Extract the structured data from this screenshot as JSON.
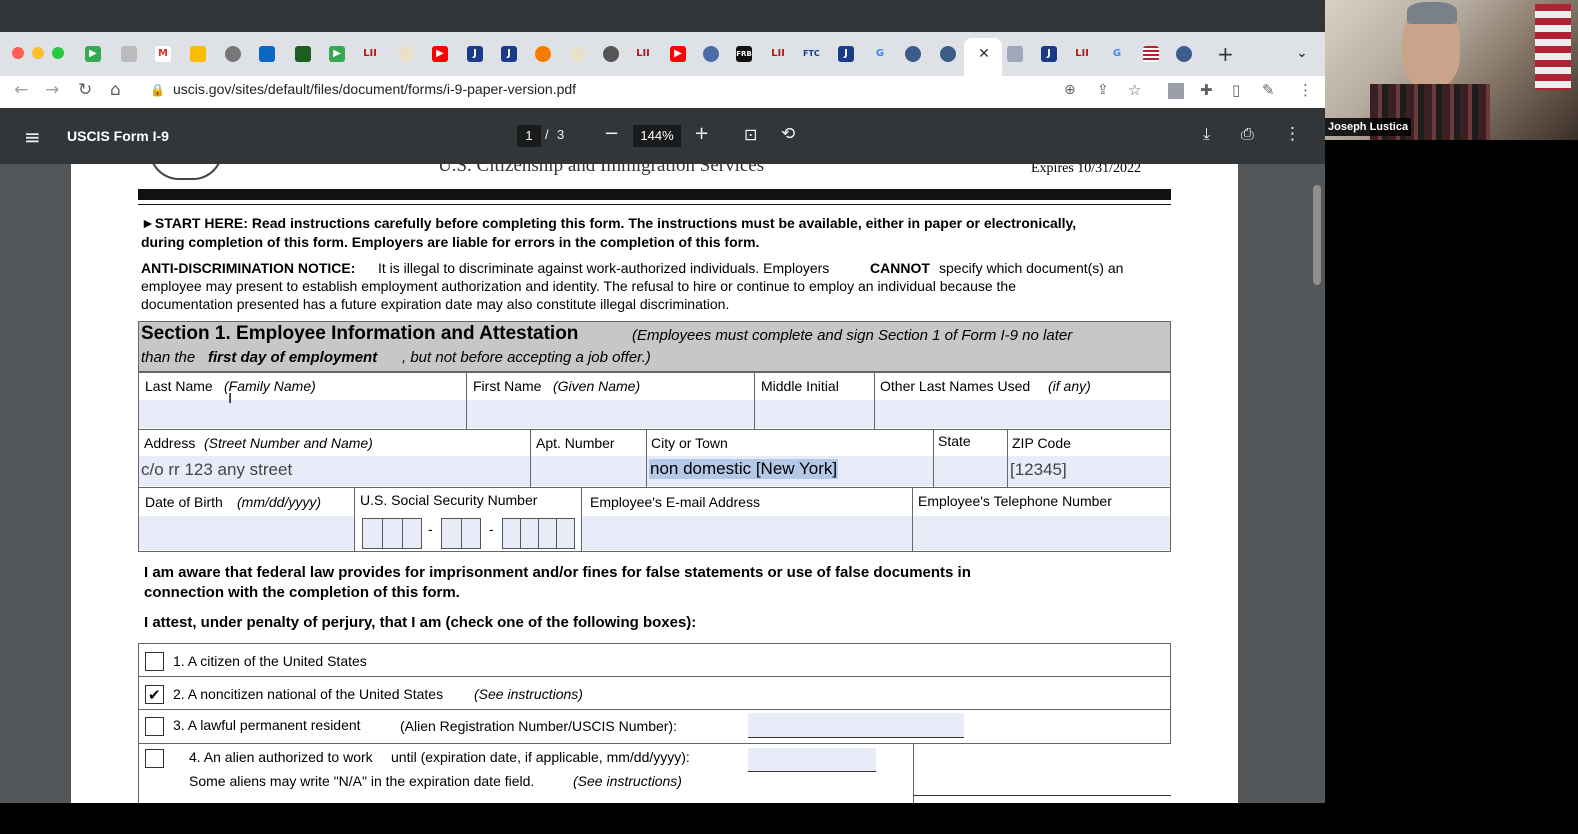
{
  "browser": {
    "url": "uscis.gov/sites/default/files/document/forms/i-9-paper-version.pdf",
    "tab_icons": [
      "LII",
      "J",
      "FRB",
      "FTC",
      "G"
    ],
    "new_tab_label": "+"
  },
  "pdf_viewer": {
    "title": "USCIS Form I-9",
    "page_current": "1",
    "page_separator": "/",
    "page_total": "3",
    "zoom": "144%"
  },
  "form": {
    "agency": "U.S. Citizenship and Immigration Services",
    "expires": "Expires 10/31/2022",
    "start_here": "►START HERE: Read instructions carefully before completing this form. The instructions must be available, either in paper or electronically,",
    "start_here_2": "during completion of this form. Employers are liable for errors in the completion of this form.",
    "anti_disc_title": "ANTI-DISCRIMINATION NOTICE:",
    "anti_disc_1a": "It is illegal to discriminate against work-authorized individuals. Employers",
    "anti_disc_cannot": "CANNOT",
    "anti_disc_1b": "specify which document(s) an",
    "anti_disc_2": "employee may present to establish employment authorization and identity. The refusal to hire or continue to employ an individual because the",
    "anti_disc_3": "documentation presented has a future expiration date may also constitute illegal discrimination.",
    "section_title": "Section 1. Employee Information and Attestation",
    "section_note_1": "(Employees must complete and sign Section 1 of Form I-9 no later",
    "section_note_2a": "than the",
    "section_note_2b": "first day of employment",
    "section_note_2c": ", but not before accepting a job offer.)",
    "last_name": "Last Name",
    "last_name_sub": "(Family Name)",
    "first_name": "First Name",
    "first_name_sub": "(Given Name)",
    "middle_initial": "Middle Initial",
    "other_last": "Other Last Names Used",
    "other_last_sub": "(if any)",
    "address": "Address",
    "address_sub": "(Street Number and Name)",
    "apt": "Apt. Number",
    "city": "City or Town",
    "state": "State",
    "zip": "ZIP Code",
    "address_value": "c/o rr 123 any street",
    "city_value": "non domestic [New York]",
    "zip_value": "[12345]",
    "dob": "Date of Birth",
    "dob_sub": "(mm/dd/yyyy)",
    "ssn": "U.S. Social Security Number",
    "ssn_dash": "-",
    "email": "Employee's E-mail Address",
    "phone": "Employee's Telephone Number",
    "aware_1": "I am aware that federal law provides for imprisonment and/or fines for false statements or use of false documents in",
    "aware_2": "connection with the completion of this form.",
    "attest": "I attest, under penalty of perjury, that I am (check one of the following boxes):",
    "opt1": "1. A citizen of the United States",
    "opt2": "2. A noncitizen national of the United States",
    "opt2_sub": "(See instructions)",
    "opt3": "3. A lawful permanent resident",
    "opt3_sub": "(Alien Registration Number/USCIS Number):",
    "opt4": "4. An alien authorized to work",
    "opt4_sub": "until (expiration date, if applicable, mm/dd/yyyy):",
    "opt4_note": "Some aliens may write \"N/A\" in the expiration date field.",
    "opt4_note_sub": "(See instructions)",
    "checked_option": 2,
    "checkmark": "✔"
  },
  "webcam": {
    "name": "Joseph Lustica"
  },
  "colors": {
    "section_bg": "#c7c7c7",
    "field_fill": "#e8ecf8",
    "highlight": "#b4c8e8"
  }
}
